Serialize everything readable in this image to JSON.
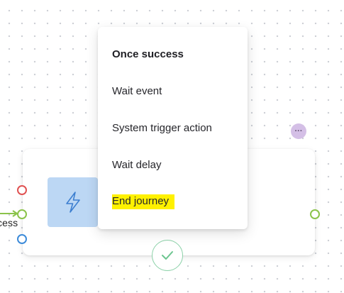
{
  "menu": {
    "heading": "Once success",
    "items": [
      {
        "label": "Wait event"
      },
      {
        "label": "System trigger action"
      },
      {
        "label": "Wait delay"
      },
      {
        "label": "End journey",
        "highlighted": true
      }
    ]
  },
  "edge": {
    "label": "cess"
  },
  "node": {
    "icon": "lightning-bolt-icon"
  },
  "colors": {
    "failure_handle": "#e05252",
    "success_handle": "#8bc34a",
    "other_handle": "#3d8bd9",
    "icon_tile": "#bcd7f4",
    "more_button": "#d4bfe6",
    "check_ring": "#8bd1a8",
    "highlight": "#fff100"
  }
}
